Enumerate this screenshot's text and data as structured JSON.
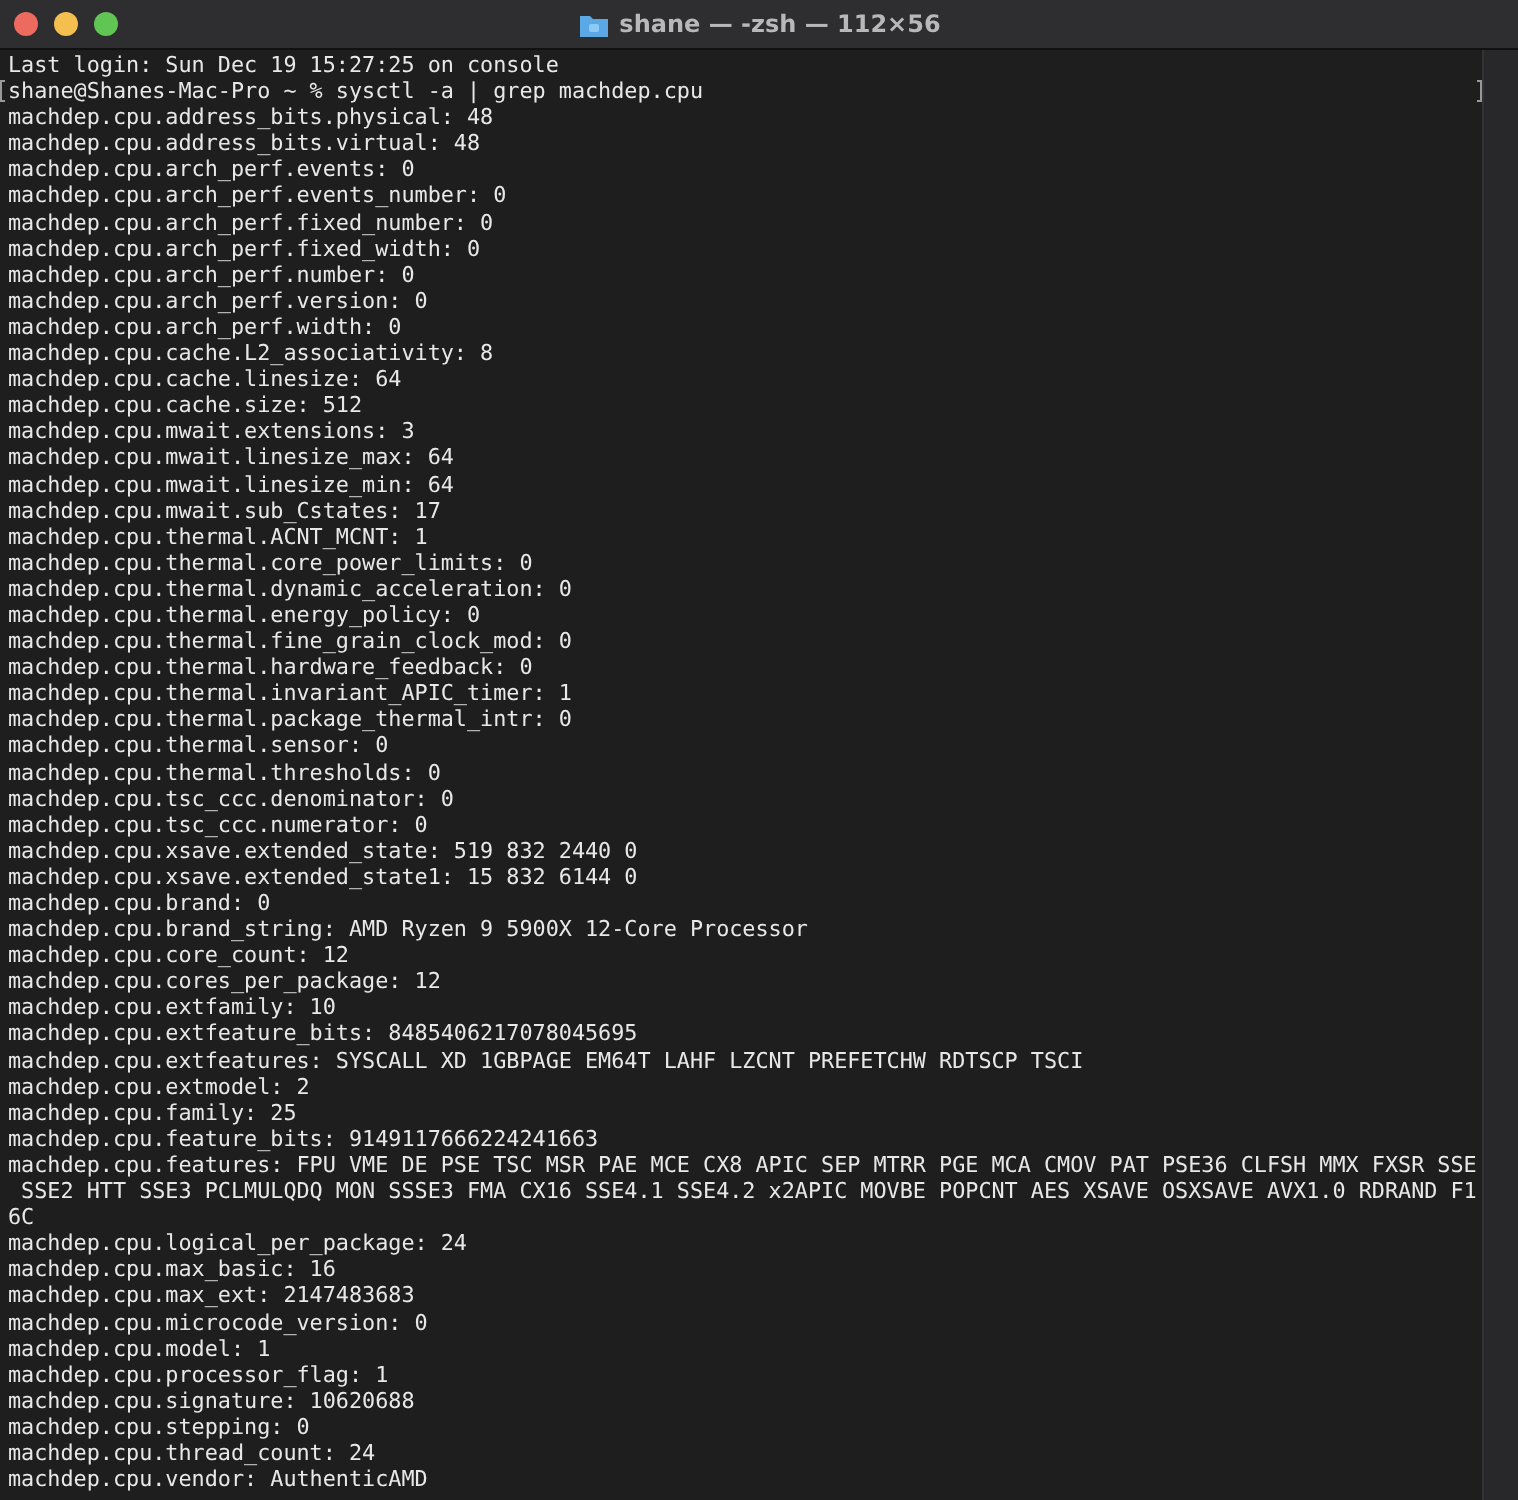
{
  "window": {
    "title": "shane — -zsh — 112×56",
    "buttons": [
      {
        "color": "#ed6a5e"
      },
      {
        "color": "#f5bf4f"
      },
      {
        "color": "#61c554"
      }
    ]
  },
  "terminal": {
    "lines": [
      {
        "text": "Last login: Sun Dec 19 15:27:25 on console",
        "marked": false
      },
      {
        "text": "shane@Shanes-Mac-Pro ~ % sysctl -a | grep machdep.cpu",
        "marked": true
      },
      {
        "text": "machdep.cpu.address_bits.physical: 48",
        "marked": false
      },
      {
        "text": "machdep.cpu.address_bits.virtual: 48",
        "marked": false
      },
      {
        "text": "machdep.cpu.arch_perf.events: 0",
        "marked": false
      },
      {
        "text": "machdep.cpu.arch_perf.events_number: 0",
        "marked": false
      },
      {
        "text": "machdep.cpu.arch_perf.fixed_number: 0",
        "marked": false
      },
      {
        "text": "machdep.cpu.arch_perf.fixed_width: 0",
        "marked": false
      },
      {
        "text": "machdep.cpu.arch_perf.number: 0",
        "marked": false
      },
      {
        "text": "machdep.cpu.arch_perf.version: 0",
        "marked": false
      },
      {
        "text": "machdep.cpu.arch_perf.width: 0",
        "marked": false
      },
      {
        "text": "machdep.cpu.cache.L2_associativity: 8",
        "marked": false
      },
      {
        "text": "machdep.cpu.cache.linesize: 64",
        "marked": false
      },
      {
        "text": "machdep.cpu.cache.size: 512",
        "marked": false
      },
      {
        "text": "machdep.cpu.mwait.extensions: 3",
        "marked": false
      },
      {
        "text": "machdep.cpu.mwait.linesize_max: 64",
        "marked": false
      },
      {
        "text": "machdep.cpu.mwait.linesize_min: 64",
        "marked": false
      },
      {
        "text": "machdep.cpu.mwait.sub_Cstates: 17",
        "marked": false
      },
      {
        "text": "machdep.cpu.thermal.ACNT_MCNT: 1",
        "marked": false
      },
      {
        "text": "machdep.cpu.thermal.core_power_limits: 0",
        "marked": false
      },
      {
        "text": "machdep.cpu.thermal.dynamic_acceleration: 0",
        "marked": false
      },
      {
        "text": "machdep.cpu.thermal.energy_policy: 0",
        "marked": false
      },
      {
        "text": "machdep.cpu.thermal.fine_grain_clock_mod: 0",
        "marked": false
      },
      {
        "text": "machdep.cpu.thermal.hardware_feedback: 0",
        "marked": false
      },
      {
        "text": "machdep.cpu.thermal.invariant_APIC_timer: 1",
        "marked": false
      },
      {
        "text": "machdep.cpu.thermal.package_thermal_intr: 0",
        "marked": false
      },
      {
        "text": "machdep.cpu.thermal.sensor: 0",
        "marked": false
      },
      {
        "text": "machdep.cpu.thermal.thresholds: 0",
        "marked": false
      },
      {
        "text": "machdep.cpu.tsc_ccc.denominator: 0",
        "marked": false
      },
      {
        "text": "machdep.cpu.tsc_ccc.numerator: 0",
        "marked": false
      },
      {
        "text": "machdep.cpu.xsave.extended_state: 519 832 2440 0",
        "marked": false
      },
      {
        "text": "machdep.cpu.xsave.extended_state1: 15 832 6144 0",
        "marked": false
      },
      {
        "text": "machdep.cpu.brand: 0",
        "marked": false
      },
      {
        "text": "machdep.cpu.brand_string: AMD Ryzen 9 5900X 12-Core Processor",
        "marked": false
      },
      {
        "text": "machdep.cpu.core_count: 12",
        "marked": false
      },
      {
        "text": "machdep.cpu.cores_per_package: 12",
        "marked": false
      },
      {
        "text": "machdep.cpu.extfamily: 10",
        "marked": false
      },
      {
        "text": "machdep.cpu.extfeature_bits: 8485406217078045695",
        "marked": false
      },
      {
        "text": "machdep.cpu.extfeatures: SYSCALL XD 1GBPAGE EM64T LAHF LZCNT PREFETCHW RDTSCP TSCI",
        "marked": false
      },
      {
        "text": "machdep.cpu.extmodel: 2",
        "marked": false
      },
      {
        "text": "machdep.cpu.family: 25",
        "marked": false
      },
      {
        "text": "machdep.cpu.feature_bits: 9149117666224241663",
        "marked": false
      },
      {
        "text": "machdep.cpu.features: FPU VME DE PSE TSC MSR PAE MCE CX8 APIC SEP MTRR PGE MCA CMOV PAT PSE36 CLFSH MMX FXSR SSE",
        "marked": false
      },
      {
        "text": " SSE2 HTT SSE3 PCLMULQDQ MON SSSE3 FMA CX16 SSE4.1 SSE4.2 x2APIC MOVBE POPCNT AES XSAVE OSXSAVE AVX1.0 RDRAND F1",
        "marked": false
      },
      {
        "text": "6C",
        "marked": false
      },
      {
        "text": "machdep.cpu.logical_per_package: 24",
        "marked": false
      },
      {
        "text": "machdep.cpu.max_basic: 16",
        "marked": false
      },
      {
        "text": "machdep.cpu.max_ext: 2147483683",
        "marked": false
      },
      {
        "text": "machdep.cpu.microcode_version: 0",
        "marked": false
      },
      {
        "text": "machdep.cpu.model: 1",
        "marked": false
      },
      {
        "text": "machdep.cpu.processor_flag: 1",
        "marked": false
      },
      {
        "text": "machdep.cpu.signature: 10620688",
        "marked": false
      },
      {
        "text": "machdep.cpu.stepping: 0",
        "marked": false
      },
      {
        "text": "machdep.cpu.thread_count: 24",
        "marked": false
      },
      {
        "text": "machdep.cpu.vendor: AuthenticAMD",
        "marked": false
      }
    ]
  }
}
